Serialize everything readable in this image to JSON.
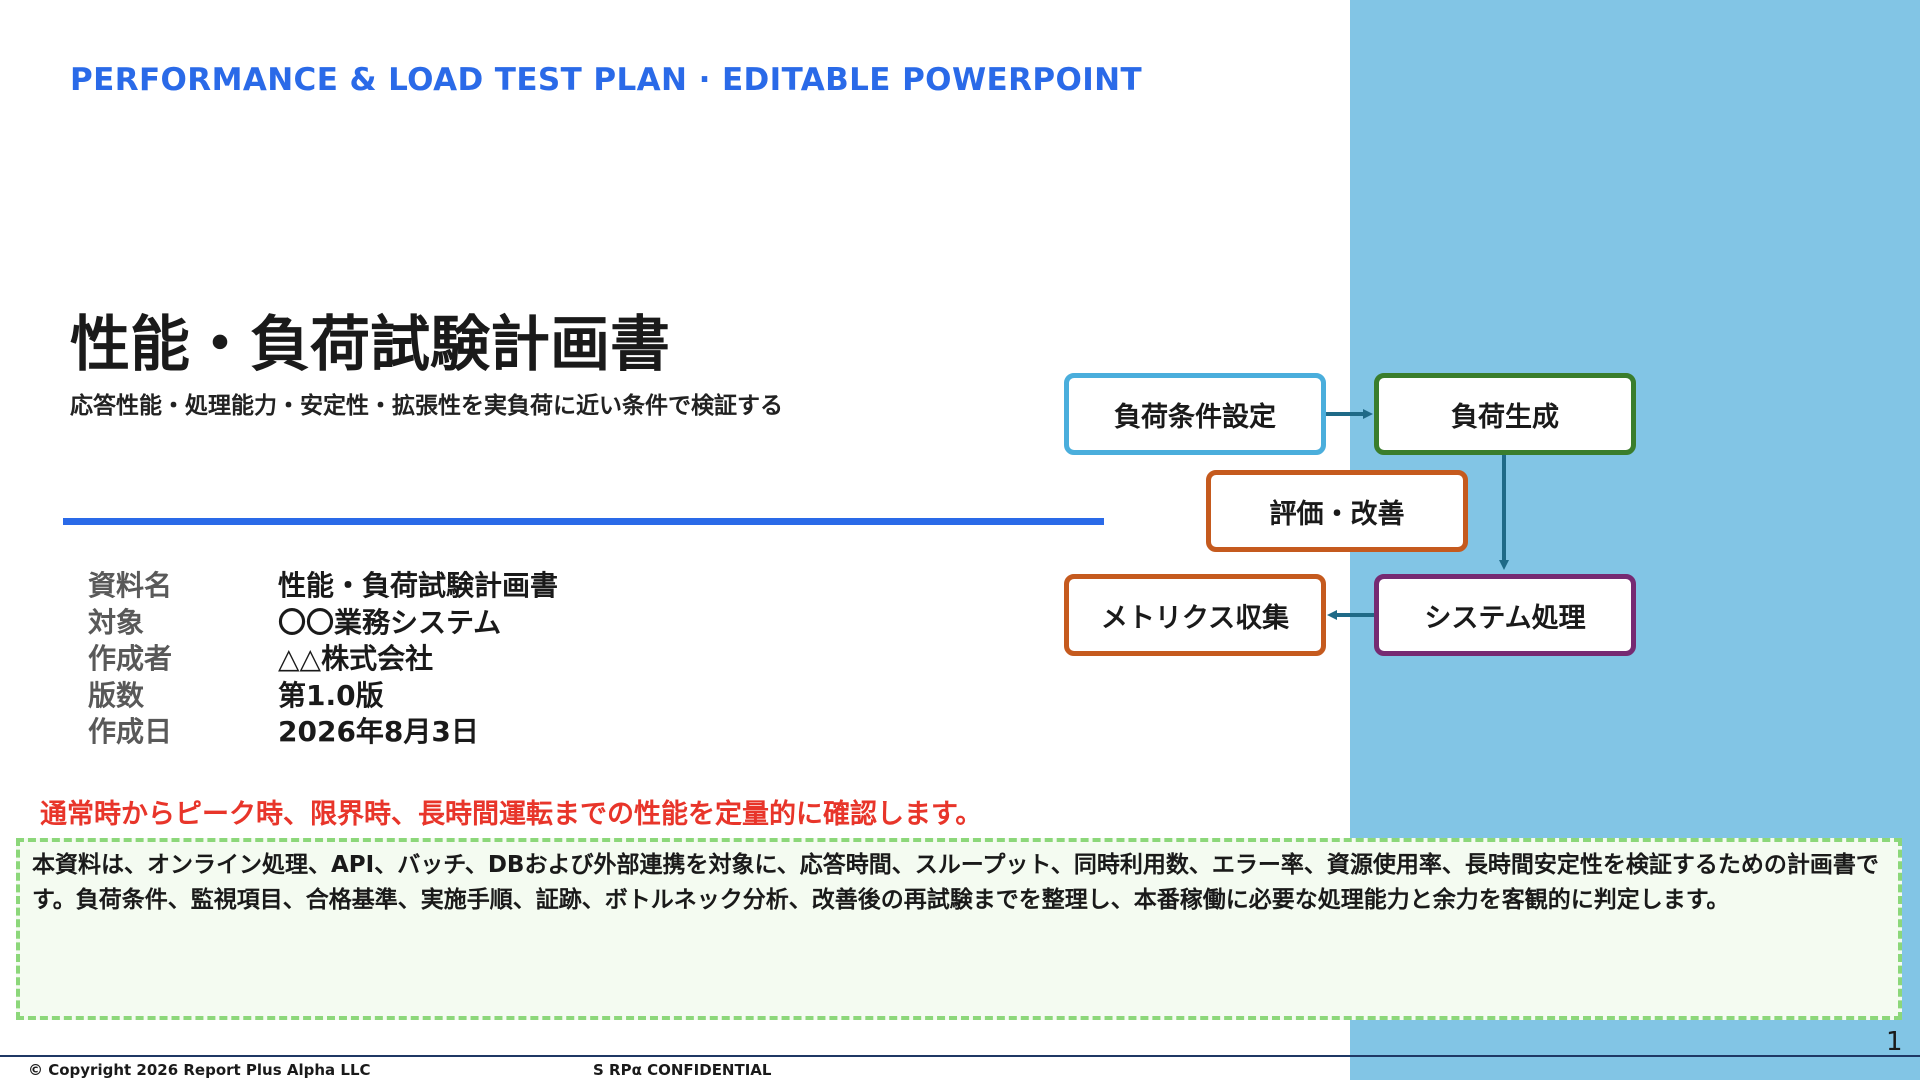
{
  "colors": {
    "accent_blue": "#2a6ae8",
    "panel_blue": "#82c5e5",
    "highlight_red": "#e8352a",
    "summary_border_green": "#8cd77a",
    "flow_light_blue": "#4aaedc",
    "flow_green": "#3a7d2c",
    "flow_orange": "#c55a1e",
    "flow_purple": "#762a72",
    "arrow_teal": "#1f6a87"
  },
  "header": {
    "banner": "PERFORMANCE & LOAD TEST PLAN · EDITABLE POWERPOINT"
  },
  "title": {
    "main": "性能・負荷試験計画書",
    "subtitle": "応答性能・処理能力・安定性・拡張性を実負荷に近い条件で検証する"
  },
  "meta": [
    {
      "label": "資料名",
      "value": "性能・負荷試験計画書"
    },
    {
      "label": "対象",
      "value": "〇〇業務システム"
    },
    {
      "label": "作成者",
      "value": "△△株式会社"
    },
    {
      "label": "版数",
      "value": "第1.0版"
    },
    {
      "label": "作成日",
      "value": "2026年8月3日"
    }
  ],
  "flow": {
    "load_conditions": "負荷条件設定",
    "load_generation": "負荷生成",
    "evaluation": "評価・改善",
    "metrics": "メトリクス収集",
    "system_processing": "システム処理"
  },
  "highlight": "通常時からピーク時、限界時、長時間運転までの性能を定量的に確認します。",
  "summary": "本資料は、オンライン処理、API、バッチ、DBおよび外部連携を対象に、応答時間、スループット、同時利用数、エラー率、資源使用率、長時間安定性を検証するための計画書です。負荷条件、監視項目、合格基準、実施手順、証跡、ボトルネック分析、改善後の再試験までを整理し、本番稼働に必要な処理能力と余力を客観的に判定します。",
  "footer": {
    "copyright": "© Copyright 2026 Report Plus Alpha LLC",
    "confidential": "S RPα CONFIDENTIAL",
    "page_number": "1"
  }
}
